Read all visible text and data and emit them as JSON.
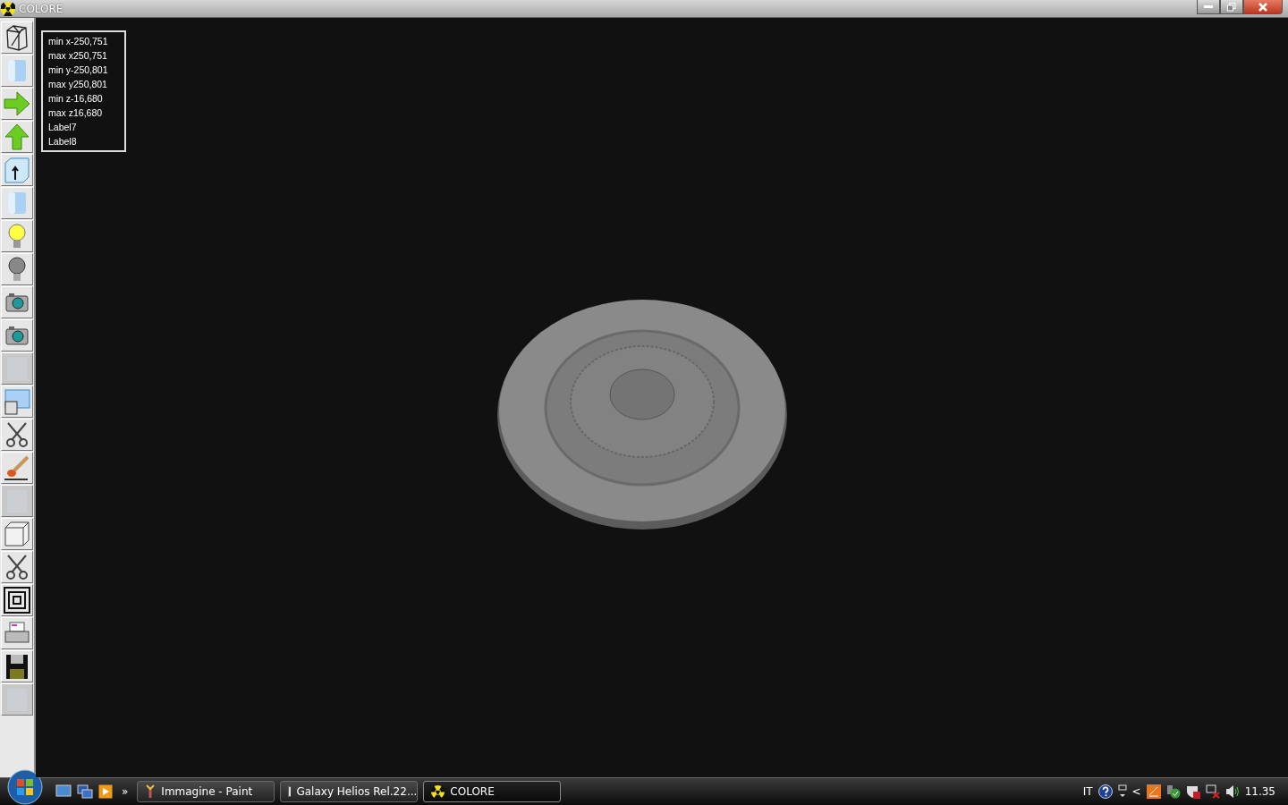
{
  "window": {
    "title": "COLORE"
  },
  "toolbar": [
    {
      "kind": "wireframe",
      "disabled": false
    },
    {
      "kind": "cylinder",
      "disabled": false
    },
    {
      "kind": "arrow-right",
      "disabled": false
    },
    {
      "kind": "arrow-up",
      "disabled": false
    },
    {
      "kind": "box-up",
      "disabled": false
    },
    {
      "kind": "cylinder",
      "disabled": false
    },
    {
      "kind": "bulb-on",
      "disabled": false
    },
    {
      "kind": "bulb-off",
      "disabled": false
    },
    {
      "kind": "camera",
      "disabled": false
    },
    {
      "kind": "camera",
      "disabled": false
    },
    {
      "kind": "blank",
      "disabled": true
    },
    {
      "kind": "window",
      "disabled": false
    },
    {
      "kind": "scissors",
      "disabled": false
    },
    {
      "kind": "brush",
      "disabled": false
    },
    {
      "kind": "blank",
      "disabled": true
    },
    {
      "kind": "cube",
      "disabled": false
    },
    {
      "kind": "scissors",
      "disabled": false
    },
    {
      "kind": "squares",
      "disabled": false
    },
    {
      "kind": "printer",
      "disabled": false
    },
    {
      "kind": "floppy",
      "disabled": false
    },
    {
      "kind": "blank",
      "disabled": true
    }
  ],
  "info_labels": [
    "min x-250,751",
    "max x250,751",
    "min y-250,801",
    "max y250,801",
    "min z-16,680",
    "max z16,680",
    "Label7",
    "Label8"
  ],
  "taskbar": {
    "more": "»",
    "tasks": [
      {
        "label": "Immagine - Paint",
        "kind": "paint",
        "selected": false
      },
      {
        "label": "Galaxy Helios  Rel.22...",
        "kind": "app",
        "selected": false
      },
      {
        "label": "COLORE",
        "kind": "radiation",
        "selected": true
      }
    ],
    "language": "IT",
    "tray_chevron": "<",
    "clock": "11.35"
  }
}
